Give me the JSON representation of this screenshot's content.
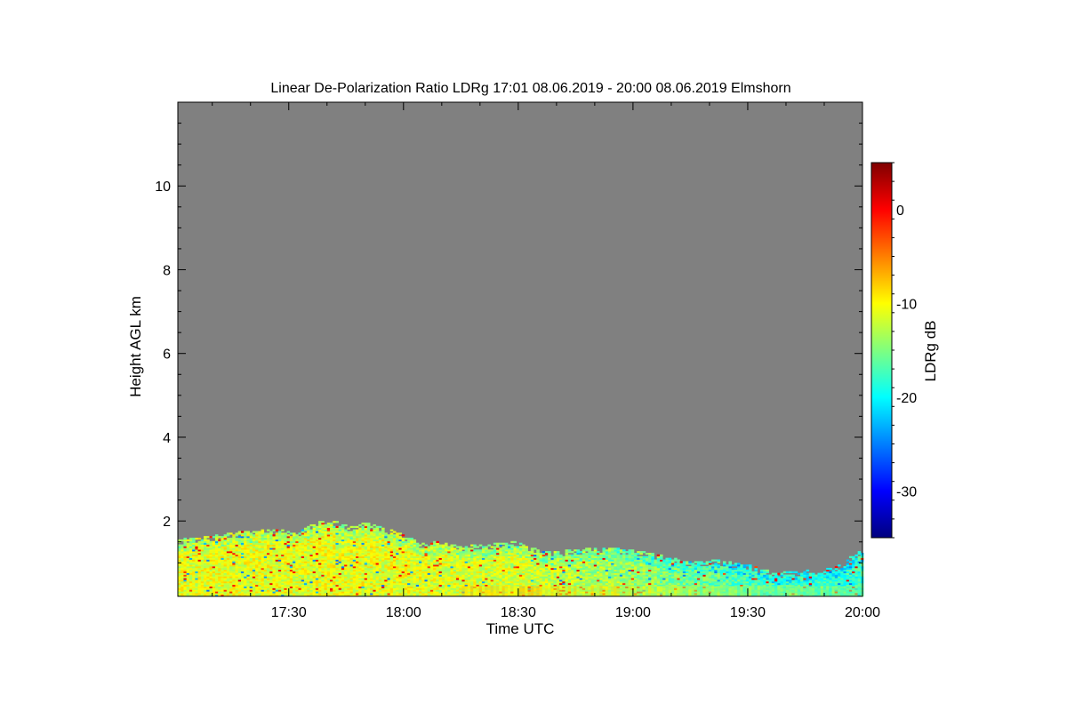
{
  "chart_data": {
    "type": "heatmap",
    "title": "Linear De-Polarization Ratio LDRg   17:01 08.06.2019 - 20:00 08.06.2019 Elmshorn",
    "xlabel": "Time UTC",
    "ylabel": "Height AGL km",
    "colorbar_label": "LDRg dB",
    "x_range_minutes_utc": [
      1021,
      1200
    ],
    "x_ticks": [
      {
        "minute": 1050,
        "label": "17:30"
      },
      {
        "minute": 1080,
        "label": "18:00"
      },
      {
        "minute": 1110,
        "label": "18:30"
      },
      {
        "minute": 1140,
        "label": "19:00"
      },
      {
        "minute": 1170,
        "label": "19:30"
      },
      {
        "minute": 1200,
        "label": "20:00"
      }
    ],
    "ylim_km": [
      0.2,
      12
    ],
    "y_ticks": [
      2,
      4,
      6,
      8,
      10
    ],
    "colorbar_range_db": [
      -35,
      5
    ],
    "colorbar_ticks": [
      0,
      -10,
      -20,
      -30
    ],
    "colormap": [
      "#00007f",
      "#0000ff",
      "#007fff",
      "#00ffff",
      "#7fff7f",
      "#ffff00",
      "#ff7f00",
      "#ff0000",
      "#7f0000"
    ],
    "background_no_signal_color": "#808080",
    "layer_top_km": [
      {
        "minute": 1021,
        "top": 1.55
      },
      {
        "minute": 1028,
        "top": 1.6
      },
      {
        "minute": 1035,
        "top": 1.7
      },
      {
        "minute": 1042,
        "top": 1.78
      },
      {
        "minute": 1048,
        "top": 1.8
      },
      {
        "minute": 1052,
        "top": 1.7
      },
      {
        "minute": 1057,
        "top": 1.95
      },
      {
        "minute": 1062,
        "top": 2.0
      },
      {
        "minute": 1066,
        "top": 1.85
      },
      {
        "minute": 1070,
        "top": 1.95
      },
      {
        "minute": 1076,
        "top": 1.8
      },
      {
        "minute": 1080,
        "top": 1.65
      },
      {
        "minute": 1085,
        "top": 1.45
      },
      {
        "minute": 1090,
        "top": 1.5
      },
      {
        "minute": 1095,
        "top": 1.38
      },
      {
        "minute": 1100,
        "top": 1.42
      },
      {
        "minute": 1105,
        "top": 1.45
      },
      {
        "minute": 1108,
        "top": 1.55
      },
      {
        "minute": 1112,
        "top": 1.4
      },
      {
        "minute": 1118,
        "top": 1.25
      },
      {
        "minute": 1125,
        "top": 1.3
      },
      {
        "minute": 1132,
        "top": 1.35
      },
      {
        "minute": 1140,
        "top": 1.3
      },
      {
        "minute": 1148,
        "top": 1.15
      },
      {
        "minute": 1155,
        "top": 1.0
      },
      {
        "minute": 1162,
        "top": 1.05
      },
      {
        "minute": 1170,
        "top": 0.95
      },
      {
        "minute": 1178,
        "top": 0.75
      },
      {
        "minute": 1185,
        "top": 0.8
      },
      {
        "minute": 1192,
        "top": 0.85
      },
      {
        "minute": 1200,
        "top": 1.3
      }
    ],
    "layer_typical_ldr_db": [
      {
        "minute": 1021,
        "ldr": -11
      },
      {
        "minute": 1080,
        "ldr": -11
      },
      {
        "minute": 1110,
        "ldr": -12
      },
      {
        "minute": 1140,
        "ldr": -14
      },
      {
        "minute": 1170,
        "ldr": -17
      },
      {
        "minute": 1200,
        "ldr": -18
      }
    ]
  }
}
